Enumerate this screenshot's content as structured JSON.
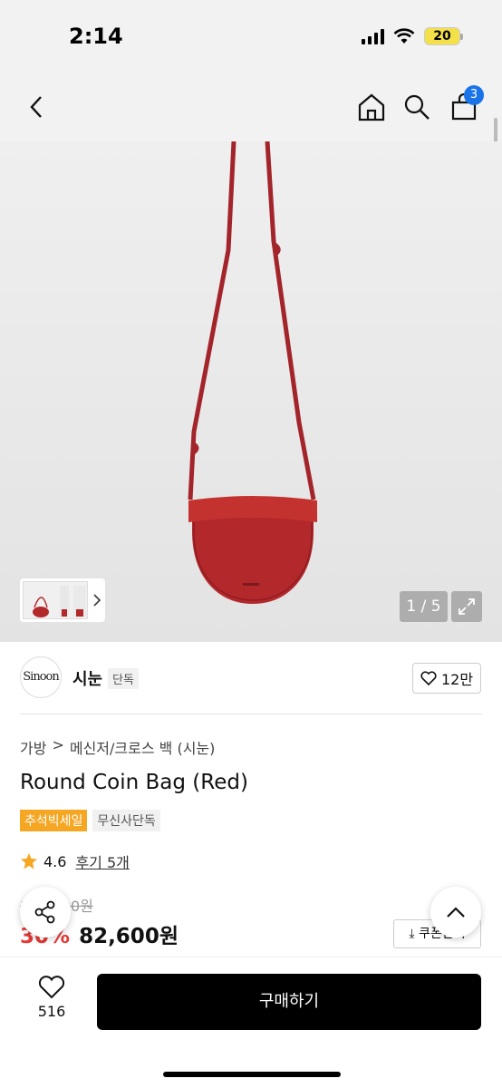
{
  "status": {
    "time": "2:14",
    "battery": "20"
  },
  "nav": {
    "cart_count": "3"
  },
  "gallery": {
    "counter": "1 / 5"
  },
  "brand": {
    "logo_text": "Sinoon",
    "name": "시눈",
    "tag": "단독",
    "likes": "12만"
  },
  "breadcrumb": {
    "category": "가방",
    "separator": ">",
    "subcategory": "메신저/크로스 백 (시눈)"
  },
  "product": {
    "title": "Round Coin Bag (Red)",
    "badge_sale": "추석빅세일",
    "badge_exclusive": "무신사단독",
    "rating": "4.6",
    "reviews": "후기 5개",
    "original_price": "118,000원",
    "discount": "30%",
    "price": "82,600원",
    "coupon_label": "쿠폰받기"
  },
  "bottom": {
    "wish_count": "516",
    "buy_label": "구매하기"
  },
  "colors": {
    "accent_blue": "#1a73e8",
    "sale_orange": "#f5a623",
    "discount_red": "#e53935",
    "bag_red": "#b3282b"
  }
}
